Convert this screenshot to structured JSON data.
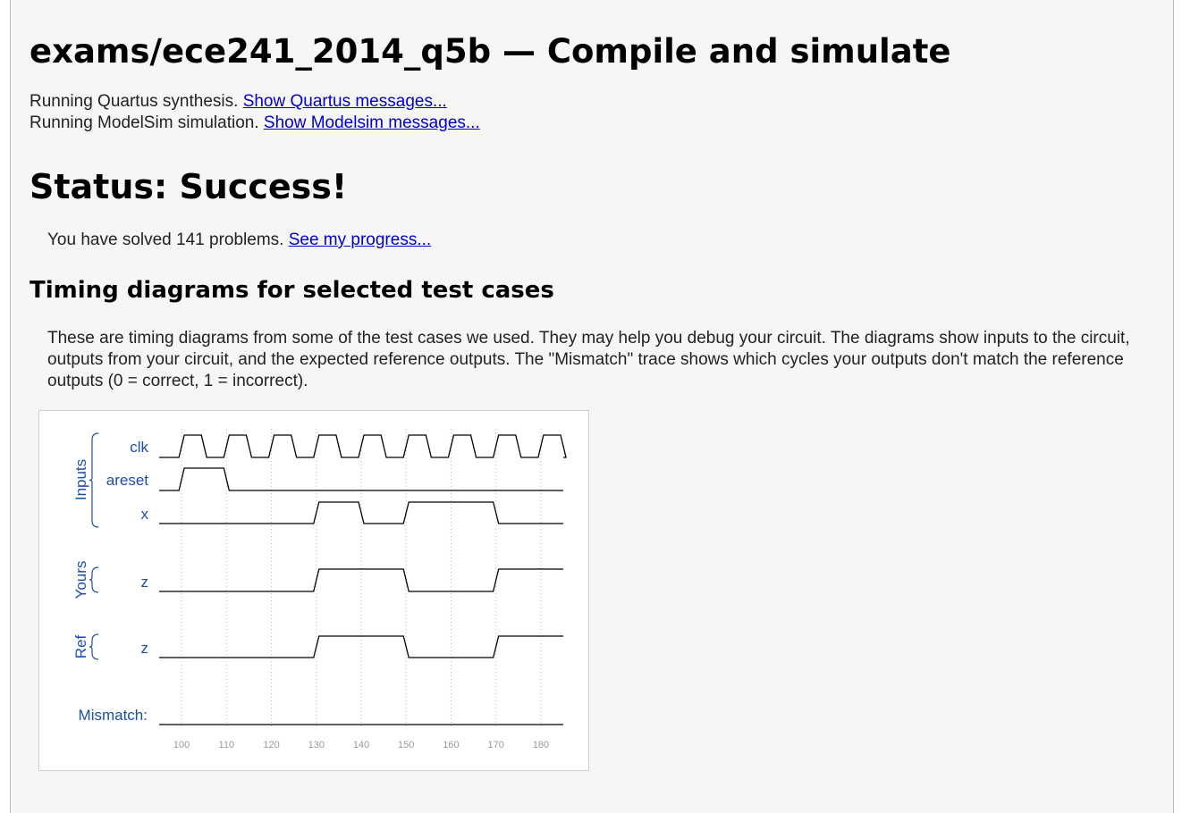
{
  "header": {
    "title": "exams/ece241_2014_q5b — Compile and simulate"
  },
  "messages": {
    "quartus_text": "Running Quartus synthesis. ",
    "quartus_link": "Show Quartus messages...",
    "modelsim_text": "Running ModelSim simulation. ",
    "modelsim_link": "Show Modelsim messages..."
  },
  "status": {
    "heading": "Status: Success!",
    "progress_text": "You have solved 141 problems. ",
    "progress_link": "See my progress..."
  },
  "timing": {
    "heading": "Timing diagrams for selected test cases",
    "description": "These are timing diagrams from some of the test cases we used. They may help you debug your circuit. The diagrams show inputs to the circuit, outputs from your circuit, and the expected reference outputs. The \"Mismatch\" trace shows which cycles your outputs don't match the reference outputs (0 = correct, 1 = incorrect)."
  },
  "colors": {
    "label_blue": "#1c4fa6",
    "signal": "#000000",
    "grid": "#bbbbbb",
    "tick": "#999999",
    "link": "#0000cc"
  },
  "chart_data": {
    "type": "table",
    "groups": [
      {
        "name": "Inputs",
        "signals": [
          "clk",
          "areset",
          "x"
        ]
      },
      {
        "name": "Yours",
        "signals": [
          "z"
        ]
      },
      {
        "name": "Ref",
        "signals": [
          "z"
        ]
      }
    ],
    "mismatch_label": "Mismatch:",
    "x_ticks": [
      100,
      110,
      120,
      130,
      140,
      150,
      160,
      170,
      180
    ],
    "xlim": [
      95,
      185
    ],
    "clock": {
      "name": "clk",
      "period": 10,
      "high_from_offset": 0,
      "first_rise": 100,
      "initial": 0
    },
    "traces": [
      {
        "name": "areset",
        "group": "Inputs",
        "initial": 0,
        "transitions": [
          [
            100,
            1
          ],
          [
            110,
            0
          ]
        ]
      },
      {
        "name": "x",
        "group": "Inputs",
        "initial": 0,
        "transitions": [
          [
            130,
            1
          ],
          [
            140,
            0
          ],
          [
            150,
            1
          ],
          [
            170,
            0
          ]
        ]
      },
      {
        "name": "z",
        "group": "Yours",
        "initial": 0,
        "transitions": [
          [
            130,
            1
          ],
          [
            150,
            0
          ],
          [
            170,
            1
          ]
        ]
      },
      {
        "name": "z",
        "group": "Ref",
        "initial": 0,
        "transitions": [
          [
            130,
            1
          ],
          [
            150,
            0
          ],
          [
            170,
            1
          ]
        ]
      },
      {
        "name": "Mismatch",
        "group": "",
        "initial": 0,
        "transitions": []
      }
    ]
  }
}
